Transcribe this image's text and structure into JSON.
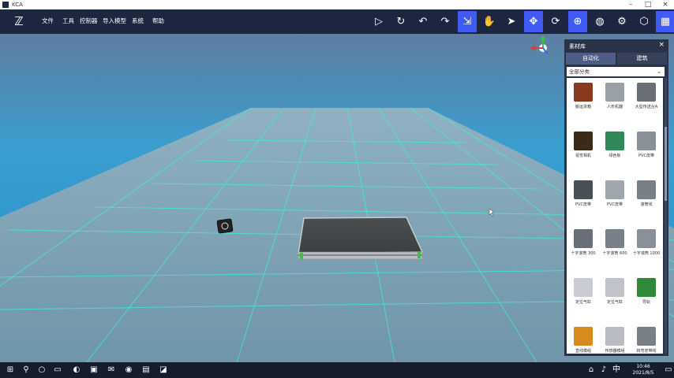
{
  "window": {
    "title": "KCA"
  },
  "menu": [
    "文件",
    "工具",
    "控制器",
    "导入模型",
    "系统",
    "帮助"
  ],
  "toolbar": {
    "buttons": [
      {
        "icon": "play-icon",
        "glyph": "▷",
        "active": false
      },
      {
        "icon": "refresh-icon",
        "glyph": "↻",
        "active": false
      },
      {
        "icon": "undo-icon",
        "glyph": "↶",
        "active": false
      },
      {
        "icon": "redo-icon",
        "glyph": "↷",
        "active": false
      },
      {
        "icon": "select-icon",
        "glyph": "⇲",
        "active": true
      },
      {
        "icon": "hand-icon",
        "glyph": "✋",
        "active": false
      },
      {
        "icon": "pointer-icon",
        "glyph": "➤",
        "active": false
      },
      {
        "icon": "move-icon",
        "glyph": "✥",
        "active": true
      },
      {
        "icon": "rotate-icon",
        "glyph": "⟳",
        "active": false
      },
      {
        "icon": "target-icon",
        "glyph": "⊕",
        "active": true
      },
      {
        "icon": "globe-icon",
        "glyph": "◍",
        "active": false
      },
      {
        "icon": "settings-icon",
        "glyph": "⚙",
        "active": false
      },
      {
        "icon": "cube-icon",
        "glyph": "⬡",
        "active": false
      },
      {
        "icon": "grid-icon",
        "glyph": "▦",
        "active": true
      }
    ]
  },
  "panel": {
    "title": "素材库",
    "close": "×",
    "tabs": [
      {
        "label": "自动化",
        "active": true
      },
      {
        "label": "建筑",
        "active": false
      }
    ],
    "filter": "全部分类",
    "items": [
      {
        "label": "搬运货箱",
        "color": "#8b3a1f"
      },
      {
        "label": "人形机器",
        "color": "#9aa0a8"
      },
      {
        "label": "大型传送台A",
        "color": "#6b7078"
      },
      {
        "label": "视觉相机",
        "color": "#3a2a18"
      },
      {
        "label": "绿色板",
        "color": "#2f8a5a"
      },
      {
        "label": "PVC皮带",
        "color": "#8a9098"
      },
      {
        "label": "PVC皮带",
        "color": "#4a5058"
      },
      {
        "label": "PVC皮带",
        "color": "#a0a6ae"
      },
      {
        "label": "滚筒线",
        "color": "#7a8088"
      },
      {
        "label": "十字滚筒 300",
        "color": "#6a7078"
      },
      {
        "label": "十字滚筒 600",
        "color": "#7a8088"
      },
      {
        "label": "十字滚筒 1000",
        "color": "#8a9098"
      },
      {
        "label": "定位气缸",
        "color": "#c8ccd2"
      },
      {
        "label": "定位气缸",
        "color": "#c0c4ca"
      },
      {
        "label": "导轨",
        "color": "#2f8a3a"
      },
      {
        "label": "直线模组",
        "color": "#d88a1a"
      },
      {
        "label": "传感器模组",
        "color": "#b8bcc2"
      },
      {
        "label": "转弯皮带线",
        "color": "#7a8088"
      }
    ]
  },
  "taskbar": {
    "time": "10:46",
    "date": "2021/8/5",
    "icons": [
      {
        "icon": "start-icon",
        "glyph": "⊞"
      },
      {
        "icon": "search-icon",
        "glyph": "⚲"
      },
      {
        "icon": "task-view-icon",
        "glyph": "○"
      },
      {
        "icon": "widgets-icon",
        "glyph": "▭"
      },
      {
        "icon": "edge-icon",
        "glyph": "◐"
      },
      {
        "icon": "store-icon",
        "glyph": "▣"
      },
      {
        "icon": "mail-icon",
        "glyph": "✉"
      },
      {
        "icon": "chrome-icon",
        "glyph": "◉"
      },
      {
        "icon": "photos-icon",
        "glyph": "▤"
      },
      {
        "icon": "kca-icon",
        "glyph": "◪"
      }
    ]
  },
  "colors": {
    "accent": "#3f5bf3",
    "toolbar_bg": "#1d2640",
    "panel_bg": "#2a3247",
    "sky": "#2fb6e6",
    "grid_line": "#3ef0d6"
  }
}
